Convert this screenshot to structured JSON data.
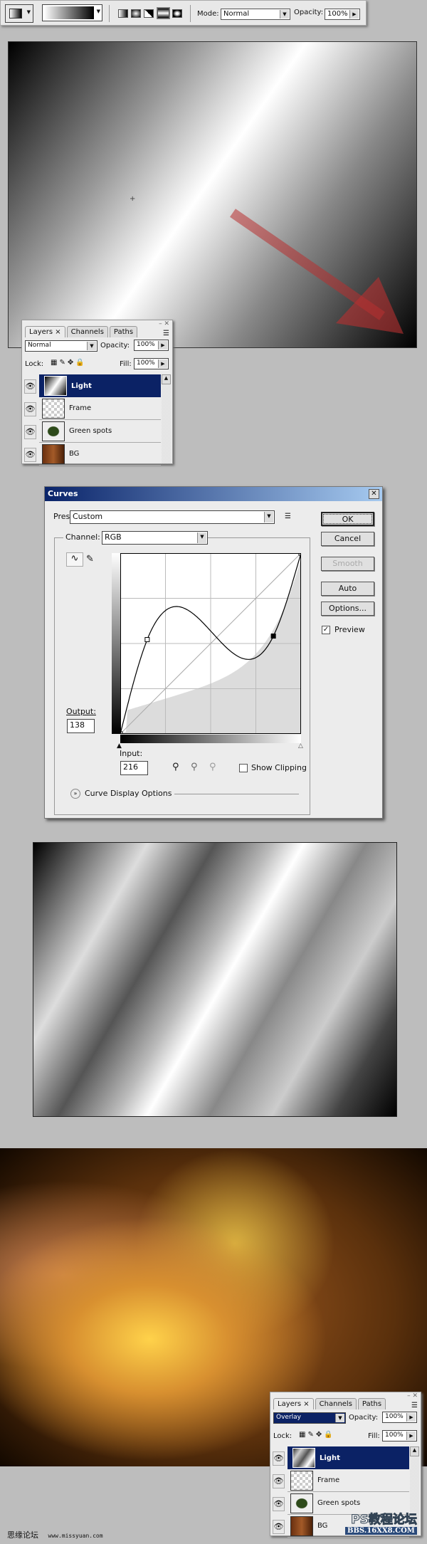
{
  "toolbar": {
    "mode_label": "Mode:",
    "mode_value": "Normal",
    "opacity_label": "Opacity:",
    "opacity_value": "100%",
    "gradient_types": [
      "linear",
      "radial",
      "angle",
      "reflected",
      "diamond"
    ],
    "active_gradient_type": "reflected"
  },
  "layers_panel_1": {
    "tabs": [
      "Layers",
      "Channels",
      "Paths"
    ],
    "blend_mode": "Normal",
    "opacity_label": "Opacity:",
    "opacity": "100%",
    "lock_label": "Lock:",
    "fill_label": "Fill:",
    "fill": "100%",
    "layers": [
      {
        "name": "Light",
        "selected": true
      },
      {
        "name": "Frame"
      },
      {
        "name": "Green spots"
      },
      {
        "name": "BG"
      }
    ]
  },
  "curves": {
    "title": "Curves",
    "preset_label": "Preset:",
    "preset": "Custom",
    "channel_label": "Channel:",
    "channel": "RGB",
    "buttons": {
      "ok": "OK",
      "cancel": "Cancel",
      "smooth": "Smooth",
      "auto": "Auto",
      "options": "Options..."
    },
    "preview_label": "Preview",
    "preview_checked": true,
    "output_label": "Output:",
    "output": "138",
    "input_label": "Input:",
    "input": "216",
    "show_clipping_label": "Show Clipping",
    "show_clipping_checked": false,
    "display_options_label": "Curve Display Options",
    "points": [
      [
        0,
        0
      ],
      [
        38,
        133
      ],
      [
        216,
        138
      ],
      [
        255,
        255
      ]
    ],
    "selected_point": 2
  },
  "layers_panel_2": {
    "tabs": [
      "Layers",
      "Channels",
      "Paths"
    ],
    "blend_mode": "Overlay",
    "opacity_label": "Opacity:",
    "opacity": "100%",
    "lock_label": "Lock:",
    "fill_label": "Fill:",
    "fill": "100%",
    "layers": [
      {
        "name": "Light",
        "selected": true
      },
      {
        "name": "Frame"
      },
      {
        "name": "Green spots"
      },
      {
        "name": "BG"
      }
    ]
  },
  "footer": {
    "site_cn": "思缘论坛",
    "site_url": "www.missyuan.com"
  },
  "watermark": {
    "line1": "PS教程论坛",
    "line2": "BBS.16XX8.COM"
  },
  "colors": {
    "selection": "#0b2265",
    "arrow": "#b83030"
  }
}
